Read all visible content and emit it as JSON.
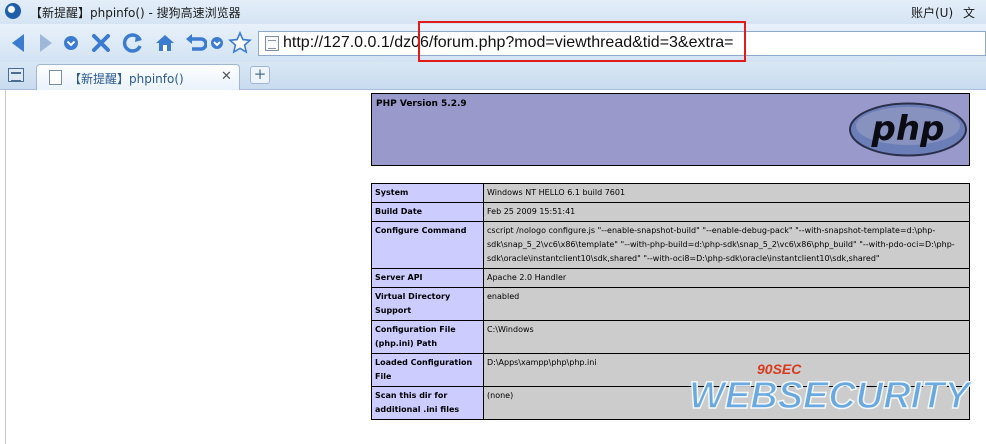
{
  "titlebar": {
    "title": "【新提醒】phpinfo() - 搜狗高速浏览器",
    "menu": [
      "账户(U)",
      "文件"
    ]
  },
  "toolbar": {
    "url": "http://127.0.0.1/dz06/forum.php?mod=viewthread&tid=3&extra="
  },
  "tabs": [
    {
      "title": "【新提醒】phpinfo()",
      "close": "✕"
    }
  ],
  "tabstrip": {
    "new_tab": "+"
  },
  "php": {
    "version": "PHP Version 5.2.9",
    "logo_text": "php",
    "rows": [
      {
        "key": "System",
        "value": "Windows NT HELLO 6.1 build 7601"
      },
      {
        "key": "Build Date",
        "value": "Feb 25 2009 15:51:41"
      },
      {
        "key": "Configure Command",
        "value": "cscript /nologo configure.js \"--enable-snapshot-build\" \"--enable-debug-pack\" \"--with-snapshot-template=d:\\php-sdk\\snap_5_2\\vc6\\x86\\template\" \"--with-php-build=d:\\php-sdk\\snap_5_2\\vc6\\x86\\php_build\" \"--with-pdo-oci=D:\\php-sdk\\oracle\\instantclient10\\sdk,shared\" \"--with-oci8=D:\\php-sdk\\oracle\\instantclient10\\sdk,shared\""
      },
      {
        "key": "Server API",
        "value": "Apache 2.0 Handler"
      },
      {
        "key": "Virtual Directory Support",
        "value": "enabled"
      },
      {
        "key": "Configuration File (php.ini) Path",
        "value": "C:\\Windows"
      },
      {
        "key": "Loaded Configuration File",
        "value": "D:\\Apps\\xampp\\php\\php.ini"
      },
      {
        "key": "Scan this dir for additional .ini files",
        "value": "(none)"
      }
    ]
  },
  "watermark": {
    "top": "90SEC",
    "main": "WEBSECURITY"
  },
  "colors": {
    "highlight": "#e11a1a",
    "php_header": "#9999cc",
    "key_cell": "#ccccff",
    "value_cell": "#cccccc",
    "nav_icons": "#2c6fbf"
  }
}
